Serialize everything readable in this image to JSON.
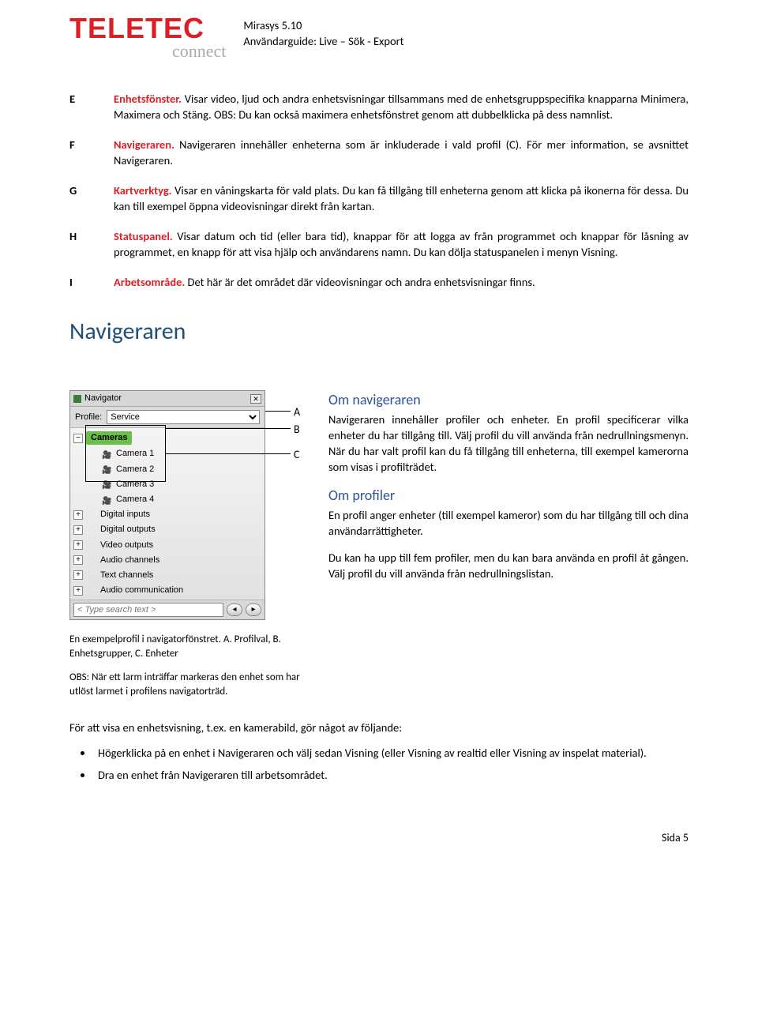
{
  "header": {
    "logo_main": "TELETEC",
    "logo_sub": "connect",
    "line1": "Mirasys 5.10",
    "line2": "Användarguide: Live – Sök - Export"
  },
  "definitions": {
    "E": {
      "letter": "E",
      "kw": "Enhetsfönster.",
      "text": " Visar video, ljud och andra enhetsvisningar tillsammans med de enhetsgruppspecifika knapparna Minimera, Maximera och Stäng. OBS: Du kan också maximera enhetsfönstret genom att dubbelklicka på dess namnlist."
    },
    "F": {
      "letter": "F",
      "kw": "Navigeraren.",
      "text": " Navigeraren innehåller enheterna som är inkluderade i vald profil (C). För mer information, se avsnittet Navigeraren."
    },
    "G": {
      "letter": "G",
      "kw": "Kartverktyg.",
      "text": " Visar en våningskarta för vald plats. Du kan få tillgång till enheterna genom att klicka på ikonerna för dessa. Du kan till exempel öppna videovisningar direkt från kartan."
    },
    "H": {
      "letter": "H",
      "kw": "Statuspanel.",
      "text": " Visar datum och tid (eller bara tid), knappar för att logga av från programmet och knappar för låsning av programmet, en knapp för att visa hjälp och användarens namn. Du kan dölja statuspanelen i menyn Visning."
    },
    "I": {
      "letter": "I",
      "kw": "Arbetsområde.",
      "text": " Det här är det området där videovisningar och andra enhetsvisningar finns."
    }
  },
  "section_title": "Navigeraren",
  "navigator": {
    "title": "Navigator",
    "profile_label": "Profile:",
    "profile_value": "Service",
    "groups": {
      "cameras": "Cameras",
      "camera1": "Camera 1",
      "camera2": "Camera 2",
      "camera3": "Camera 3",
      "camera4": "Camera 4",
      "digital_inputs": "Digital inputs",
      "digital_outputs": "Digital outputs",
      "video_outputs": "Video outputs",
      "audio_channels": "Audio channels",
      "text_channels": "Text channels",
      "audio_comm": "Audio communication"
    },
    "search_placeholder": "< Type search text >"
  },
  "callouts": {
    "A": "A",
    "B": "B",
    "C": "C"
  },
  "right": {
    "h_about_nav": "Om navigeraren",
    "p_about_nav": "Navigeraren innehåller profiler och enheter. En profil specificerar vilka enheter du har tillgång till. Välj profil du vill använda från nedrullningsmenyn. När du har valt profil kan du få tillgång till enheterna, till exempel kamerorna som visas i profilträdet.",
    "h_profiles": "Om profiler",
    "p_profiles": "En profil anger enheter (till exempel kameror) som du har tillgång till och dina användarrättigheter.",
    "p_profiles2": "Du kan ha upp till fem profiler, men du kan bara använda en profil åt gången. Välj profil du vill använda från nedrullningslistan."
  },
  "captions": {
    "c1": "En exempelprofil i navigatorfönstret. A. Profilval, B. Enhetsgrupper, C. Enheter",
    "c2": "OBS: När ett larm inträffar markeras den enhet som har utlöst larmet i profilens navigatorträd."
  },
  "below": {
    "intro": "För att visa en enhetsvisning, t.ex. en kamerabild, gör något av följande:",
    "b1": "Högerklicka på en enhet i Navigeraren och välj sedan Visning (eller Visning av realtid eller Visning av inspelat material).",
    "b2": "Dra en enhet från Navigeraren till arbetsområdet."
  },
  "footer": "Sida 5"
}
